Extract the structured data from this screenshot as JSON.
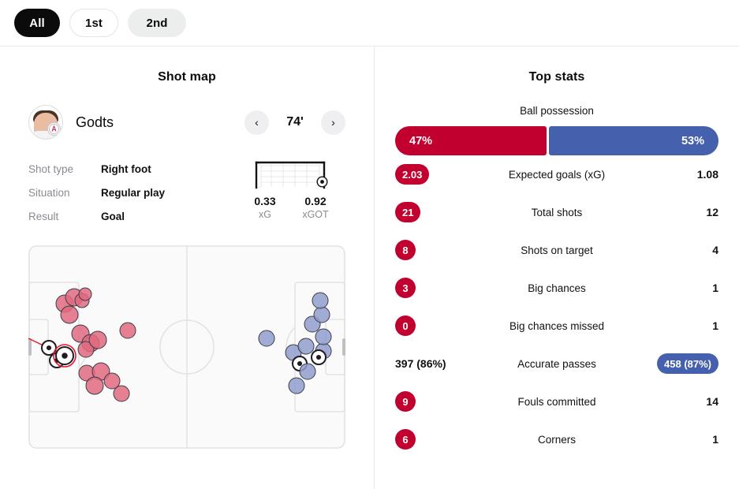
{
  "filters": {
    "items": [
      {
        "label": "All",
        "state": "active"
      },
      {
        "label": "1st",
        "state": "outline"
      },
      {
        "label": "2nd",
        "state": "grey"
      }
    ]
  },
  "shot_map": {
    "title": "Shot map",
    "player": {
      "name": "Godts",
      "avatar_icon": "player-photo",
      "team_badge_icon": "club-crest",
      "badge_text": "AJAX"
    },
    "nav": {
      "prev_icon": "chevron-left-icon",
      "next_icon": "chevron-right-icon",
      "minute": "74'"
    },
    "details": [
      {
        "label": "Shot type",
        "value": "Right foot"
      },
      {
        "label": "Situation",
        "value": "Regular play"
      },
      {
        "label": "Result",
        "value": "Goal"
      }
    ],
    "goal_graphic": {
      "icon": "goal-net-icon",
      "ball_icon": "football-icon"
    },
    "xg": [
      {
        "value": "0.33",
        "label": "xG"
      },
      {
        "value": "0.92",
        "label": "xGOT"
      }
    ],
    "colors": {
      "home_shot": "#e0697f",
      "away_shot": "#8f9dcd",
      "home_accent": "#C2002F",
      "away_accent": "#4560AC",
      "pitch_line": "#dcdcde",
      "pitch_bg": "#fafafa"
    }
  },
  "top_stats": {
    "title": "Top stats",
    "possession": {
      "label": "Ball possession",
      "home": "47%",
      "away": "53%",
      "home_pct": 47,
      "away_pct": 53
    },
    "rows": [
      {
        "label": "Expected goals (xG)",
        "home": "2.03",
        "away": "1.08",
        "home_style": "chip-red",
        "away_style": "plain"
      },
      {
        "label": "Total shots",
        "home": "21",
        "away": "12",
        "home_style": "chip-red",
        "away_style": "plain"
      },
      {
        "label": "Shots on target",
        "home": "8",
        "away": "4",
        "home_style": "chip-red",
        "away_style": "plain"
      },
      {
        "label": "Big chances",
        "home": "3",
        "away": "1",
        "home_style": "chip-red",
        "away_style": "plain"
      },
      {
        "label": "Big chances missed",
        "home": "0",
        "away": "1",
        "home_style": "chip-red",
        "away_style": "plain"
      },
      {
        "label": "Accurate passes",
        "home": "397 (86%)",
        "away": "458 (87%)",
        "home_style": "plain",
        "away_style": "chip-blue"
      },
      {
        "label": "Fouls committed",
        "home": "9",
        "away": "14",
        "home_style": "chip-red",
        "away_style": "plain"
      },
      {
        "label": "Corners",
        "home": "6",
        "away": "1",
        "home_style": "chip-red",
        "away_style": "plain"
      }
    ]
  },
  "chart_data": {
    "type": "scatter",
    "title": "Shot map",
    "xlabel": "",
    "ylabel": "",
    "xlim": [
      0,
      400
    ],
    "ylim": [
      0,
      256
    ],
    "grid": false,
    "legend": "none",
    "note": "Football pitch shot locations. Home team (red) attacks to the left goal; away team (blue) attacks to the right goal. r = marker radius in pitch px; goal=true markers drawn as football glyphs.",
    "series": [
      {
        "name": "Home shots",
        "color": "#e0697f",
        "points": [
          {
            "x": 46,
            "y": 74,
            "r": 11,
            "goal": false
          },
          {
            "x": 58,
            "y": 66,
            "r": 11,
            "goal": false
          },
          {
            "x": 68,
            "y": 70,
            "r": 9,
            "goal": false
          },
          {
            "x": 52,
            "y": 88,
            "r": 11,
            "goal": false
          },
          {
            "x": 72,
            "y": 62,
            "r": 8,
            "goal": false
          },
          {
            "x": 66,
            "y": 112,
            "r": 11,
            "goal": false
          },
          {
            "x": 79,
            "y": 124,
            "r": 11,
            "goal": false
          },
          {
            "x": 73,
            "y": 132,
            "r": 10,
            "goal": false
          },
          {
            "x": 88,
            "y": 120,
            "r": 11,
            "goal": false
          },
          {
            "x": 126,
            "y": 108,
            "r": 10,
            "goal": false
          },
          {
            "x": 26,
            "y": 130,
            "r": 9,
            "goal": true
          },
          {
            "x": 36,
            "y": 146,
            "r": 9,
            "goal": true
          },
          {
            "x": 46,
            "y": 140,
            "r": 11,
            "goal": true
          },
          {
            "x": 74,
            "y": 162,
            "r": 10,
            "goal": false
          },
          {
            "x": 92,
            "y": 160,
            "r": 11,
            "goal": false
          },
          {
            "x": 84,
            "y": 178,
            "r": 11,
            "goal": false
          },
          {
            "x": 106,
            "y": 172,
            "r": 10,
            "goal": false
          },
          {
            "x": 118,
            "y": 188,
            "r": 10,
            "goal": false
          }
        ]
      },
      {
        "name": "Away shots",
        "color": "#8f9dcd",
        "points": [
          {
            "x": 302,
            "y": 118,
            "r": 10,
            "goal": false
          },
          {
            "x": 336,
            "y": 136,
            "r": 10,
            "goal": false
          },
          {
            "x": 352,
            "y": 128,
            "r": 10,
            "goal": false
          },
          {
            "x": 344,
            "y": 150,
            "r": 9,
            "goal": true
          },
          {
            "x": 360,
            "y": 100,
            "r": 10,
            "goal": false
          },
          {
            "x": 374,
            "y": 134,
            "r": 10,
            "goal": false
          },
          {
            "x": 374,
            "y": 116,
            "r": 10,
            "goal": false
          },
          {
            "x": 372,
            "y": 88,
            "r": 10,
            "goal": false
          },
          {
            "x": 370,
            "y": 70,
            "r": 10,
            "goal": false
          },
          {
            "x": 368,
            "y": 142,
            "r": 9,
            "goal": true
          },
          {
            "x": 354,
            "y": 160,
            "r": 10,
            "goal": false
          },
          {
            "x": 340,
            "y": 178,
            "r": 10,
            "goal": false
          }
        ]
      }
    ]
  }
}
